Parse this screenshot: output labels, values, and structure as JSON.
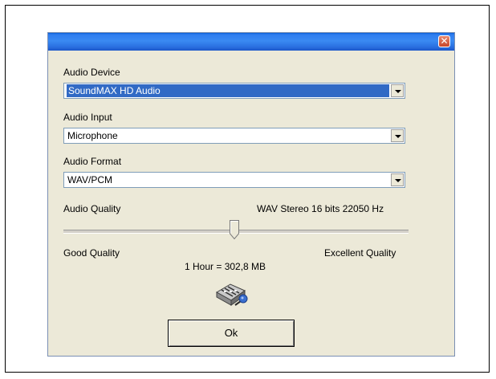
{
  "dialog": {
    "close_glyph": "✕",
    "audio_device": {
      "label": "Audio Device",
      "value": "SoundMAX HD Audio"
    },
    "audio_input": {
      "label": "Audio Input",
      "value": "Microphone"
    },
    "audio_format": {
      "label": "Audio Format",
      "value": "WAV/PCM"
    },
    "audio_quality": {
      "label": "Audio Quality",
      "format_text": "WAV Stereo 16 bits 22050 Hz",
      "slider_level": 0.5,
      "min_label": "Good Quality",
      "max_label": "Excellent Quality",
      "size_text": "1 Hour =  302,8 MB"
    },
    "ok_label": "Ok",
    "icon": "mixer-microphone-icon"
  },
  "colors": {
    "titlebar": "#2f7df0",
    "dialog_bg": "#ece9d8",
    "selection": "#316ac5",
    "close_button": "#c9472a"
  }
}
